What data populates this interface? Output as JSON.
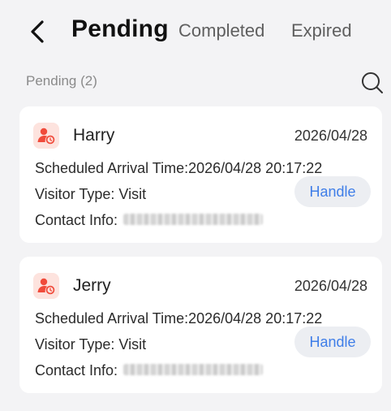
{
  "header": {
    "tabs": [
      {
        "label": "Pending",
        "active": true
      },
      {
        "label": "Completed",
        "active": false
      },
      {
        "label": "Expired",
        "active": false
      }
    ]
  },
  "list": {
    "section_label": "Pending (2)",
    "items": [
      {
        "name": "Harry",
        "date": "2026/04/28",
        "arrival": "Scheduled Arrival Time:2026/04/28 20:17:22",
        "visitor_type": "Visitor Type: Visit",
        "contact_label": "Contact Info:",
        "action": "Handle"
      },
      {
        "name": "Jerry",
        "date": "2026/04/28",
        "arrival": "Scheduled Arrival Time:2026/04/28 20:17:22",
        "visitor_type": "Visitor Type: Visit",
        "contact_label": "Contact Info:",
        "action": "Handle"
      }
    ]
  },
  "icons": {
    "back": "chevron-left-icon",
    "search": "search-icon",
    "visitor": "visitor-icon"
  },
  "colors": {
    "accent": "#3f7ee8",
    "avatar_bg": "#fde3de",
    "avatar_icon": "#f04b3b",
    "background": "#f3f3f5"
  }
}
